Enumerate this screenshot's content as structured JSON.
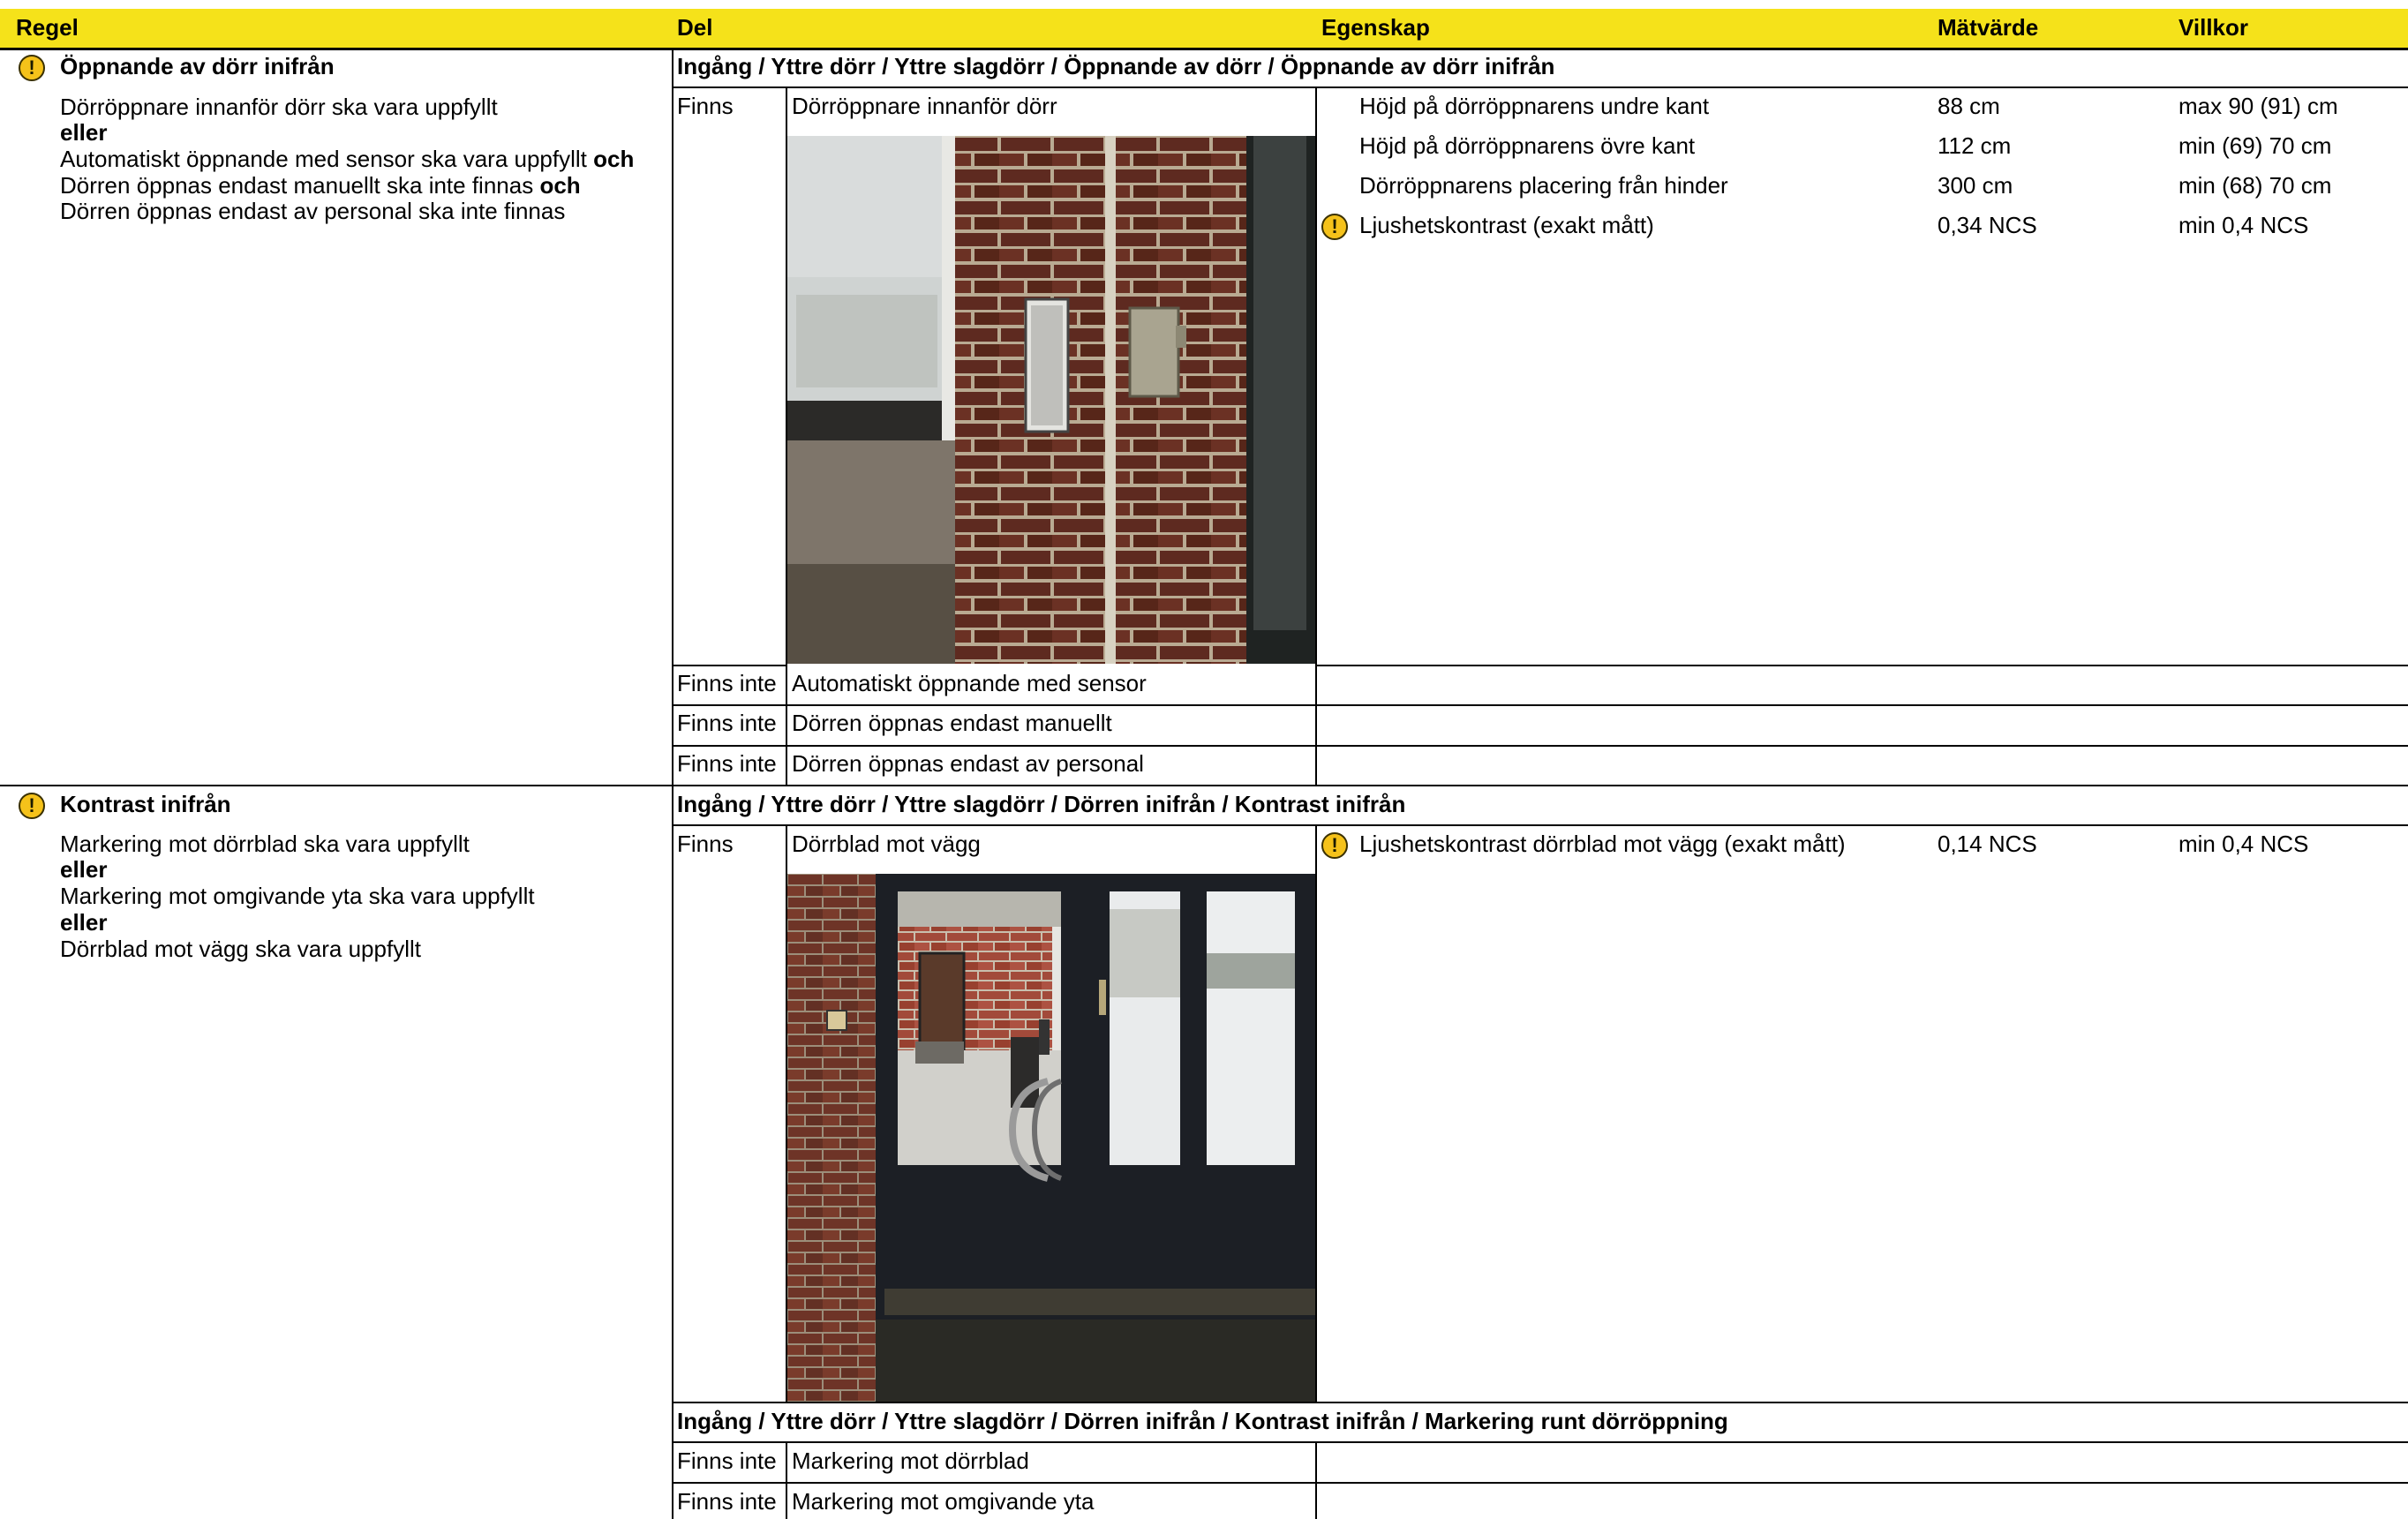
{
  "header": {
    "col_regel": "Regel",
    "col_del": "Del",
    "col_egenskap": "Egenskap",
    "col_matvarde": "Mätvärde",
    "col_villkor": "Villkor"
  },
  "colors": {
    "header_bg": "#f5e21a",
    "warning": "#f5c21a"
  },
  "rules": [
    {
      "title": "Öppnande av dörr inifrån",
      "icon": "warning-icon",
      "lines": {
        "l1": "Dörröppnare innanför dörr ska vara uppfyllt",
        "l2": "eller",
        "l3a": "Automatiskt öppnande med sensor ska vara uppfyllt ",
        "l3b": "och",
        "l4a": "Dörren öppnas endast manuellt ska inte finnas ",
        "l4b": "och",
        "l5": "Dörren öppnas endast av personal ska inte finnas"
      },
      "path": "Ingång / Yttre dörr / Yttre slagdörr  / Öppnande av dörr / Öppnande av dörr inifrån",
      "parts": [
        {
          "status": "Finns",
          "name": "Dörröppnare innanför dörr",
          "photo_alt": "photo-door-opener",
          "properties": [
            {
              "name": "Höjd på dörröppnarens undre kant",
              "value": "88 cm",
              "condition": "max 90 (91) cm",
              "warning": false
            },
            {
              "name": "Höjd på dörröppnarens övre kant",
              "value": "112 cm",
              "condition": "min (69) 70 cm",
              "warning": false
            },
            {
              "name": "Dörröppnarens placering från hinder",
              "value": "300 cm",
              "condition": "min (68) 70 cm",
              "warning": false
            },
            {
              "name": "Ljushetskontrast (exakt mått)",
              "value": "0,34 NCS",
              "condition": "min 0,4 NCS",
              "warning": true
            }
          ]
        },
        {
          "status": "Finns inte",
          "name": "Automatiskt öppnande med sensor"
        },
        {
          "status": "Finns inte",
          "name": "Dörren öppnas endast manuellt"
        },
        {
          "status": "Finns inte",
          "name": "Dörren öppnas endast av personal"
        }
      ]
    },
    {
      "title": "Kontrast inifrån",
      "icon": "warning-icon",
      "lines": {
        "l1": "Markering mot dörrblad ska vara uppfyllt",
        "l2": "eller",
        "l3": "Markering mot omgivande yta ska vara uppfyllt",
        "l4": "eller",
        "l5": "Dörrblad mot vägg ska vara uppfyllt"
      },
      "path": "Ingång / Yttre dörr / Yttre slagdörr  / Dörren inifrån / Kontrast inifrån",
      "parts": [
        {
          "status": "Finns",
          "name": "Dörrblad mot vägg",
          "photo_alt": "photo-door-leaf-wall",
          "properties": [
            {
              "name": "Ljushetskontrast dörrblad mot vägg (exakt mått)",
              "value": "0,14 NCS",
              "condition": "min 0,4 NCS",
              "warning": true
            }
          ]
        }
      ],
      "sub_path": "Ingång / Yttre dörr / Yttre slagdörr  / Dörren inifrån / Kontrast inifrån / Markering runt dörröppning",
      "sub_parts": [
        {
          "status": "Finns inte",
          "name": "Markering mot dörrblad"
        },
        {
          "status": "Finns inte",
          "name": "Markering mot omgivande yta"
        }
      ]
    }
  ]
}
